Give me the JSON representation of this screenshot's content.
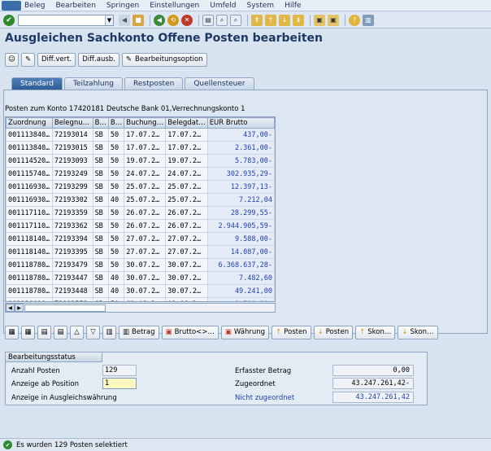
{
  "menu": [
    "Beleg",
    "Bearbeiten",
    "Springen",
    "Einstellungen",
    "Umfeld",
    "System",
    "Hilfe"
  ],
  "title": "Ausgleichen Sachkonto Offene Posten bearbeiten",
  "app_toolbar": {
    "diff_vert": "Diff.vert.",
    "diff_ausb": "Diff.ausb.",
    "bearbeitungsoption": "Bearbeitungsoption"
  },
  "tabs": [
    "Standard",
    "Teilzahlung",
    "Restposten",
    "Quellensteuer"
  ],
  "grid": {
    "title": "Posten zum Konto 17420181 Deutsche Bank 01,Verrechnungskonto 1",
    "columns": [
      "Zuordnung",
      "Belegnu…",
      "B…",
      "B…",
      "Buchung…",
      "Belegdat…",
      "EUR Brutto"
    ],
    "rows": [
      [
        "001113840…",
        "72193014",
        "SB",
        "50",
        "17.07.2…",
        "17.07.2…",
        "437,00-"
      ],
      [
        "001113840…",
        "72193015",
        "SB",
        "50",
        "17.07.2…",
        "17.07.2…",
        "2.361,00-"
      ],
      [
        "001114520…",
        "72193093",
        "SB",
        "50",
        "19.07.2…",
        "19.07.2…",
        "5.783,00-"
      ],
      [
        "001115740…",
        "72193249",
        "SB",
        "50",
        "24.07.2…",
        "24.07.2…",
        "302.935,29-"
      ],
      [
        "001116930…",
        "72193299",
        "SB",
        "50",
        "25.07.2…",
        "25.07.2…",
        "12.397,13-"
      ],
      [
        "001116930…",
        "72193302",
        "SB",
        "40",
        "25.07.2…",
        "25.07.2…",
        "7.212,04"
      ],
      [
        "001117110…",
        "72193359",
        "SB",
        "50",
        "26.07.2…",
        "26.07.2…",
        "28.299,55-"
      ],
      [
        "001117110…",
        "72193362",
        "SB",
        "50",
        "26.07.2…",
        "26.07.2…",
        "2.944.905,59-"
      ],
      [
        "001118140…",
        "72193394",
        "SB",
        "50",
        "27.07.2…",
        "27.07.2…",
        "9.588,00-"
      ],
      [
        "001118140…",
        "72193395",
        "SB",
        "50",
        "27.07.2…",
        "27.07.2…",
        "14.087,00-"
      ],
      [
        "001118780…",
        "72193479",
        "SB",
        "50",
        "30.07.2…",
        "30.07.2…",
        "6.368.637,28-"
      ],
      [
        "001118780…",
        "72193447",
        "SB",
        "40",
        "30.07.2…",
        "30.07.2…",
        "7.482,60"
      ],
      [
        "001118780…",
        "72193448",
        "SB",
        "40",
        "30.07.2…",
        "30.07.2…",
        "49.241,00"
      ],
      [
        "001120010…",
        "72193553",
        "SB",
        "50",
        "01.08.2…",
        "01.08.2…",
        "1.500,00-"
      ]
    ]
  },
  "grid_toolbar": {
    "betrag": "Betrag",
    "brutto": "Brutto<>…",
    "waehrung": "Währung",
    "posten1": "Posten",
    "posten2": "Posten",
    "skon1": "Skon…",
    "skon2": "Skon…"
  },
  "status": {
    "header": "Bearbeitungsstatus",
    "anzahl_label": "Anzahl Posten",
    "anzahl_value": "129",
    "ab_position_label": "Anzeige ab Position",
    "ab_position_value": "1",
    "ausgleich_label": "Anzeige in Ausgleichswährung",
    "erfasst_label": "Erfasster Betrag",
    "erfasst_value": "0,00",
    "zugeordnet_label": "Zugeordnet",
    "zugeordnet_value": "43.247.261,42-",
    "nicht_label": "Nicht zugeordnet",
    "nicht_value": "43.247.261,42"
  },
  "statusbar": "Es wurden 129 Posten selektiert"
}
